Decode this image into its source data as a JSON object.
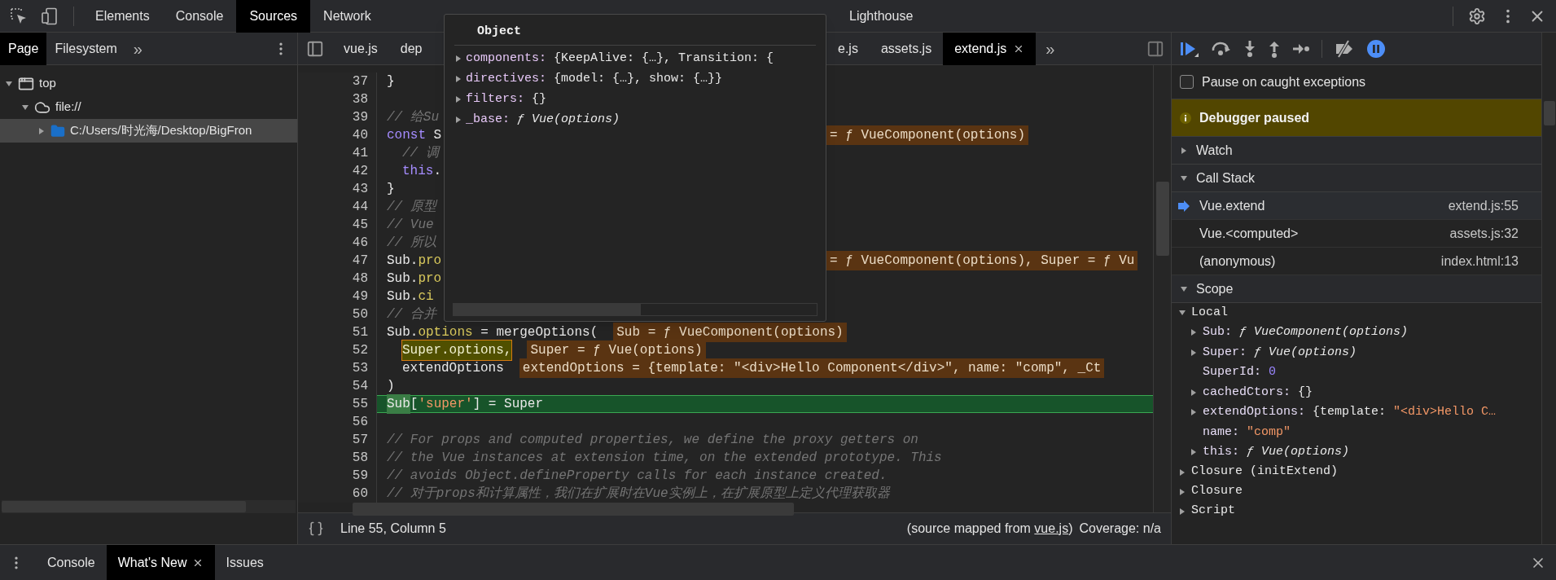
{
  "toolbar": {
    "tabs": [
      {
        "label": "Elements",
        "selected": false
      },
      {
        "label": "Console",
        "selected": false
      },
      {
        "label": "Sources",
        "selected": true
      },
      {
        "label": "Network",
        "selected": false
      }
    ],
    "tabs_after_popup": [
      {
        "label": "Lighthouse",
        "selected": false
      }
    ]
  },
  "navigator": {
    "tabs": [
      {
        "label": "Page",
        "selected": true
      },
      {
        "label": "Filesystem",
        "selected": false
      }
    ],
    "more": "»",
    "tree": [
      {
        "label": "top",
        "expanded": true,
        "selected": false,
        "children": [
          {
            "label": "file://",
            "expanded": true,
            "selected": false,
            "children": [
              {
                "label": "C:/Users/时光海/Desktop/BigFron",
                "expanded": false,
                "selected": true
              }
            ]
          }
        ]
      }
    ]
  },
  "editor_tabs": {
    "before_popup": [
      {
        "label": "vue.js",
        "selected": false,
        "closable": false
      },
      {
        "label": "dep",
        "selected": false,
        "closable": false
      }
    ],
    "after_popup": [
      {
        "label": "e.js",
        "selected": false,
        "closable": false
      },
      {
        "label": "assets.js",
        "selected": false,
        "closable": false
      },
      {
        "label": "extend.js",
        "selected": true,
        "closable": true
      }
    ],
    "more": "»"
  },
  "code": [
    {
      "number": "37",
      "current": false,
      "indented": false,
      "code": [
        {
          "text": "}",
          "kind": "plain"
        }
      ]
    },
    {
      "number": "38",
      "current": false
    },
    {
      "number": "39",
      "current": false,
      "indented": false,
      "code": [
        {
          "text": "// 给Su",
          "kind": "comment"
        }
      ]
    },
    {
      "number": "40",
      "current": false,
      "indented": false,
      "code": [
        {
          "text": "const",
          "kind": "keyword"
        },
        {
          "text": " S",
          "kind": "plain"
        }
      ],
      "tail": [
        {
          "text": "= ƒ VueComponent(options)",
          "kind": "inline"
        }
      ]
    },
    {
      "number": "41",
      "current": false,
      "indented": true,
      "code": [
        {
          "text": "// 调",
          "kind": "comment"
        }
      ]
    },
    {
      "number": "42",
      "current": false,
      "indented": true,
      "code": [
        {
          "text": "this",
          "kind": "keyword"
        },
        {
          "text": ".",
          "kind": "plain"
        }
      ]
    },
    {
      "number": "43",
      "current": false,
      "indented": false,
      "code": [
        {
          "text": "}",
          "kind": "plain"
        }
      ]
    },
    {
      "number": "44",
      "current": false,
      "indented": false,
      "code": [
        {
          "text": "// 原型",
          "kind": "comment"
        }
      ]
    },
    {
      "number": "45",
      "current": false,
      "indented": false,
      "code": [
        {
          "text": "// Vue",
          "kind": "comment"
        }
      ]
    },
    {
      "number": "46",
      "current": false,
      "indented": false,
      "code": [
        {
          "text": "// 所以",
          "kind": "comment"
        }
      ]
    },
    {
      "number": "47",
      "current": false,
      "indented": false,
      "code": [
        {
          "text": "Sub.",
          "kind": "plain"
        },
        {
          "text": "pro",
          "kind": "property"
        }
      ],
      "tail": [
        {
          "text": "= ƒ VueComponent(options), Super = ƒ Vu",
          "kind": "inline"
        }
      ]
    },
    {
      "number": "48",
      "current": false,
      "indented": false,
      "code": [
        {
          "text": "Sub.",
          "kind": "plain"
        },
        {
          "text": "pro",
          "kind": "property"
        }
      ]
    },
    {
      "number": "49",
      "current": false,
      "indented": false,
      "code": [
        {
          "text": "Sub.",
          "kind": "plain"
        },
        {
          "text": "ci",
          "kind": "property"
        }
      ]
    },
    {
      "number": "50",
      "current": false,
      "indented": false,
      "code": [
        {
          "text": "// 合并",
          "kind": "comment"
        }
      ]
    },
    {
      "number": "51",
      "current": false,
      "indented": false,
      "code": [
        {
          "text": "Sub.",
          "kind": "plain"
        },
        {
          "text": "options",
          "kind": "property"
        },
        {
          "text": " = mergeOptions(",
          "kind": "plain"
        },
        {
          "text": "Sub = ƒ VueComponent(options)",
          "kind": "inline"
        }
      ]
    },
    {
      "number": "52",
      "current": false,
      "indented": true,
      "code": [
        {
          "text": "Super.options,",
          "kind": "highlight"
        },
        {
          "text": "Super = ƒ Vue(options)",
          "kind": "inline"
        }
      ]
    },
    {
      "number": "53",
      "current": false,
      "indented": true,
      "code": [
        {
          "text": "extendOptions",
          "kind": "plain"
        },
        {
          "text": "extendOptions = {template: \"<div>Hello Component</div>\", name: \"comp\", _Ct",
          "kind": "inline"
        }
      ]
    },
    {
      "number": "54",
      "current": false,
      "indented": false,
      "code": [
        {
          "text": ")",
          "kind": "plain"
        }
      ]
    },
    {
      "number": "55",
      "current": true,
      "indented": false,
      "code": [
        {
          "text": "Sub",
          "kind": "exec"
        },
        {
          "text": "[",
          "kind": "plain"
        },
        {
          "text": "'super'",
          "kind": "string"
        },
        {
          "text": "] = Super",
          "kind": "plain"
        }
      ]
    },
    {
      "number": "56",
      "current": false
    },
    {
      "number": "57",
      "current": false,
      "indented": false,
      "code": [
        {
          "text": "// For props and computed properties, we define the proxy getters on",
          "kind": "comment"
        }
      ]
    },
    {
      "number": "58",
      "current": false,
      "indented": false,
      "code": [
        {
          "text": "// the Vue instances at extension time, on the extended prototype. This",
          "kind": "comment"
        }
      ]
    },
    {
      "number": "59",
      "current": false,
      "indented": false,
      "code": [
        {
          "text": "// avoids Object.defineProperty calls for each instance created.",
          "kind": "comment"
        }
      ]
    },
    {
      "number": "60",
      "current": false,
      "indented": false,
      "code": [
        {
          "text": "// 对于props和计算属性，我们在扩展时在Vue实例上，在扩展原型上定义代理获取器",
          "kind": "comment"
        }
      ]
    }
  ],
  "popup": {
    "title": "Object",
    "properties": [
      {
        "name": "components:",
        "value": [
          {
            "text": "{KeepAlive: {…}, Transition: {",
            "kind": "plain"
          }
        ]
      },
      {
        "name": "directives:",
        "value": [
          {
            "text": "{model: {…}, show: {…}}",
            "kind": "plain"
          }
        ]
      },
      {
        "name": "filters:",
        "value": [
          {
            "text": "{}",
            "kind": "plain"
          }
        ]
      },
      {
        "name": "_base:",
        "value": [
          {
            "text": "ƒ Vue(options)",
            "kind": "func"
          }
        ]
      }
    ]
  },
  "status_bar": {
    "position": "Line 55, Column 5",
    "source_before": "(source mapped from ",
    "source_link": "vue.js",
    "source_after": ")",
    "coverage": "Coverage: n/a"
  },
  "debugger": {
    "pause_on_caught": {
      "label": "Pause on caught exceptions",
      "checked": false
    },
    "banner": "Debugger paused",
    "sections": [
      {
        "kind": "watch",
        "label": "Watch",
        "expanded": false
      },
      {
        "kind": "call_stack",
        "label": "Call Stack",
        "expanded": true,
        "frames": [
          {
            "name": "Vue.extend",
            "location": "extend.js:55",
            "selected": true
          },
          {
            "name": "Vue.<computed>",
            "location": "assets.js:32",
            "selected": false
          },
          {
            "name": "(anonymous)",
            "location": "index.html:13",
            "selected": false
          }
        ]
      },
      {
        "kind": "scope",
        "label": "Scope",
        "expanded": true,
        "scopes": [
          {
            "label": "Local",
            "expanded": true,
            "items": [
              {
                "name": "Sub:",
                "expandable": true,
                "value": [
                  {
                    "text": "ƒ VueComponent(options)",
                    "kind": "func"
                  }
                ]
              },
              {
                "name": "Super:",
                "expandable": true,
                "value": [
                  {
                    "text": "ƒ Vue(options)",
                    "kind": "func"
                  }
                ]
              },
              {
                "name": "SuperId:",
                "expandable": false,
                "value": [
                  {
                    "text": "0",
                    "kind": "number"
                  }
                ]
              },
              {
                "name": "cachedCtors:",
                "expandable": true,
                "value": [
                  {
                    "text": "{}",
                    "kind": "plain"
                  }
                ]
              },
              {
                "name": "extendOptions:",
                "expandable": true,
                "value": [
                  {
                    "text": "{template: ",
                    "kind": "plain"
                  },
                  {
                    "text": "\"<div>Hello C…",
                    "kind": "string"
                  }
                ]
              },
              {
                "name": "name:",
                "expandable": false,
                "value": [
                  {
                    "text": "\"comp\"",
                    "kind": "string"
                  }
                ]
              },
              {
                "name": "this:",
                "expandable": true,
                "value": [
                  {
                    "text": "ƒ Vue(options)",
                    "kind": "func"
                  }
                ]
              }
            ]
          },
          {
            "label": "Closure (initExtend)",
            "expanded": false
          },
          {
            "label": "Closure",
            "expanded": false
          },
          {
            "label": "Script",
            "expanded": false
          }
        ]
      }
    ]
  },
  "drawer": {
    "tabs": [
      {
        "label": "Console",
        "selected": false,
        "closable": false
      },
      {
        "label": "What's New",
        "selected": true,
        "closable": true
      },
      {
        "label": "Issues",
        "selected": false,
        "closable": false
      }
    ]
  }
}
